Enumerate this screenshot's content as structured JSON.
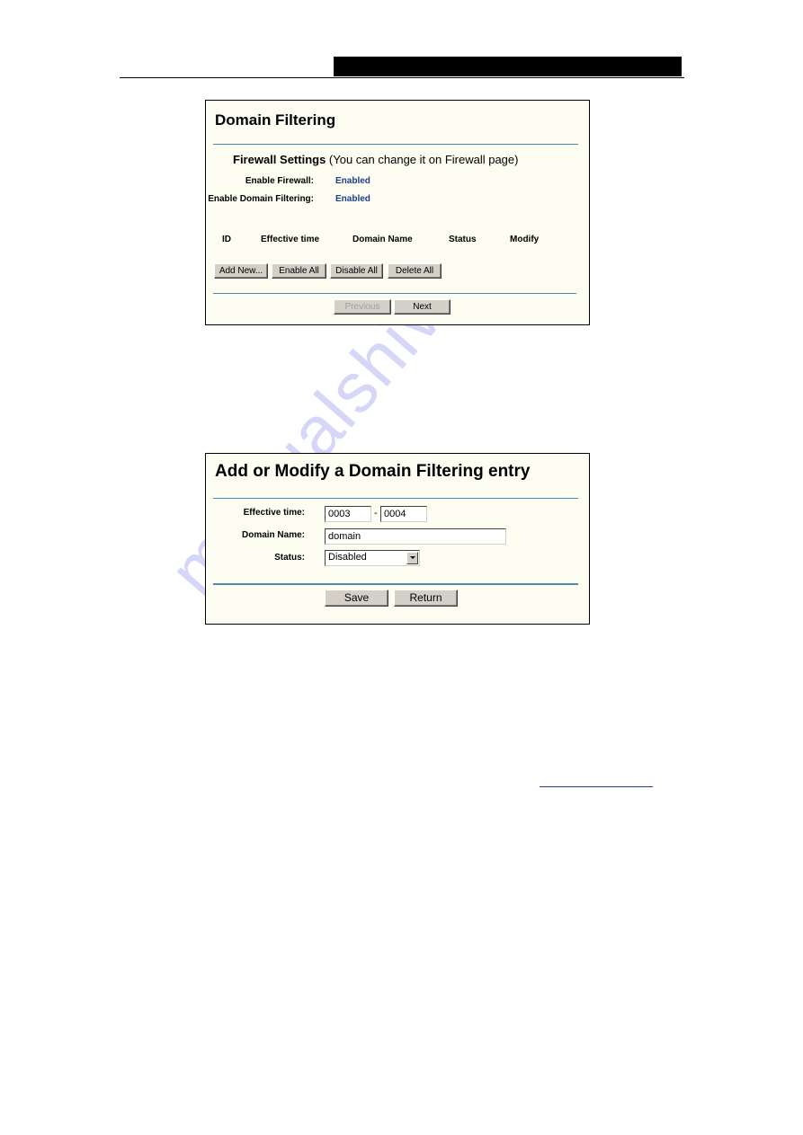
{
  "page_header": {
    "bar_color": "#000000"
  },
  "domain_filtering": {
    "title": "Domain Filtering",
    "section_title_bold": "Firewall Settings",
    "section_title_note": " (You can change it on Firewall page)",
    "enable_firewall_label": "Enable Firewall:",
    "enable_firewall_value": "Enabled",
    "enable_domain_filtering_label": "Enable Domain Filtering:",
    "enable_domain_filtering_value": "Enabled",
    "columns": [
      "ID",
      "Effective time",
      "Domain Name",
      "Status",
      "Modify"
    ],
    "buttons": {
      "add_new": "Add New...",
      "enable_all": "Enable All",
      "disable_all": "Disable All",
      "delete_all": "Delete All",
      "previous": "Previous",
      "next": "Next"
    }
  },
  "add_modify_entry": {
    "title": "Add or Modify a Domain Filtering entry",
    "effective_time_label": "Effective time:",
    "effective_time_start": "0003",
    "effective_time_separator": "-",
    "effective_time_end": "0004",
    "domain_name_label": "Domain Name:",
    "domain_name_value": "domain",
    "status_label": "Status:",
    "status_value": "Disabled",
    "buttons": {
      "save": "Save",
      "return": "Return"
    }
  },
  "watermark": {
    "text": "manualshive.com"
  },
  "colors": {
    "panel_bg": "#fdfdf2",
    "divider": "#4a8ab8",
    "value_text": "#1d3f8a",
    "button_face": "#d4d0c8"
  }
}
